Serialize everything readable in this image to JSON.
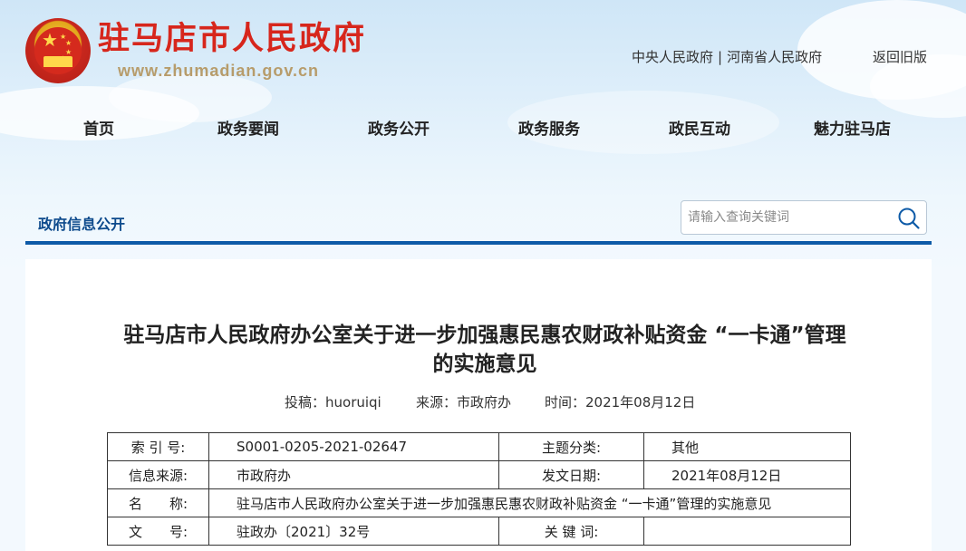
{
  "header": {
    "site_title": "驻马店市人民政府",
    "site_url": "www.zhumadian.gov.cn",
    "top_links": [
      "中央人民政府",
      "河南省人民政府"
    ],
    "top_link_sep": "|",
    "back_old": "返回旧版"
  },
  "nav": {
    "items": [
      "首页",
      "政务要闻",
      "政务公开",
      "政务服务",
      "政民互动",
      "魅力驻马店"
    ]
  },
  "section": {
    "label": "政府信息公开"
  },
  "search": {
    "placeholder": "请输入查询关键词"
  },
  "article": {
    "title": "驻马店市人民政府办公室关于进一步加强惠民惠农财政补贴资金 “一卡通”管理的实施意见",
    "meta": {
      "author": "投稿：huoruiqi",
      "source": "来源：市政府办",
      "time": "时间：2021年08月12日"
    }
  },
  "info_table": {
    "rows": [
      {
        "k1": "索 引 号:",
        "v1": "S0001-0205-2021-02647",
        "k2": "主题分类:",
        "v2": "其他"
      },
      {
        "k1": "信息来源:",
        "v1": "市政府办",
        "k2": "发文日期:",
        "v2": "2021年08月12日"
      },
      {
        "k1": "名　　称:",
        "full": "驻马店市人民政府办公室关于进一步加强惠民惠农财政补贴资金 “一卡通”管理的实施意见"
      },
      {
        "k1": "文　　号:",
        "v1": "驻政办〔2021〕32号",
        "k2": "关 键 词:",
        "v2": ""
      }
    ]
  },
  "colors": {
    "title_red": "#d7261c",
    "nav_blue": "#0d5aa7",
    "section_blue": "#0d4a8c"
  }
}
